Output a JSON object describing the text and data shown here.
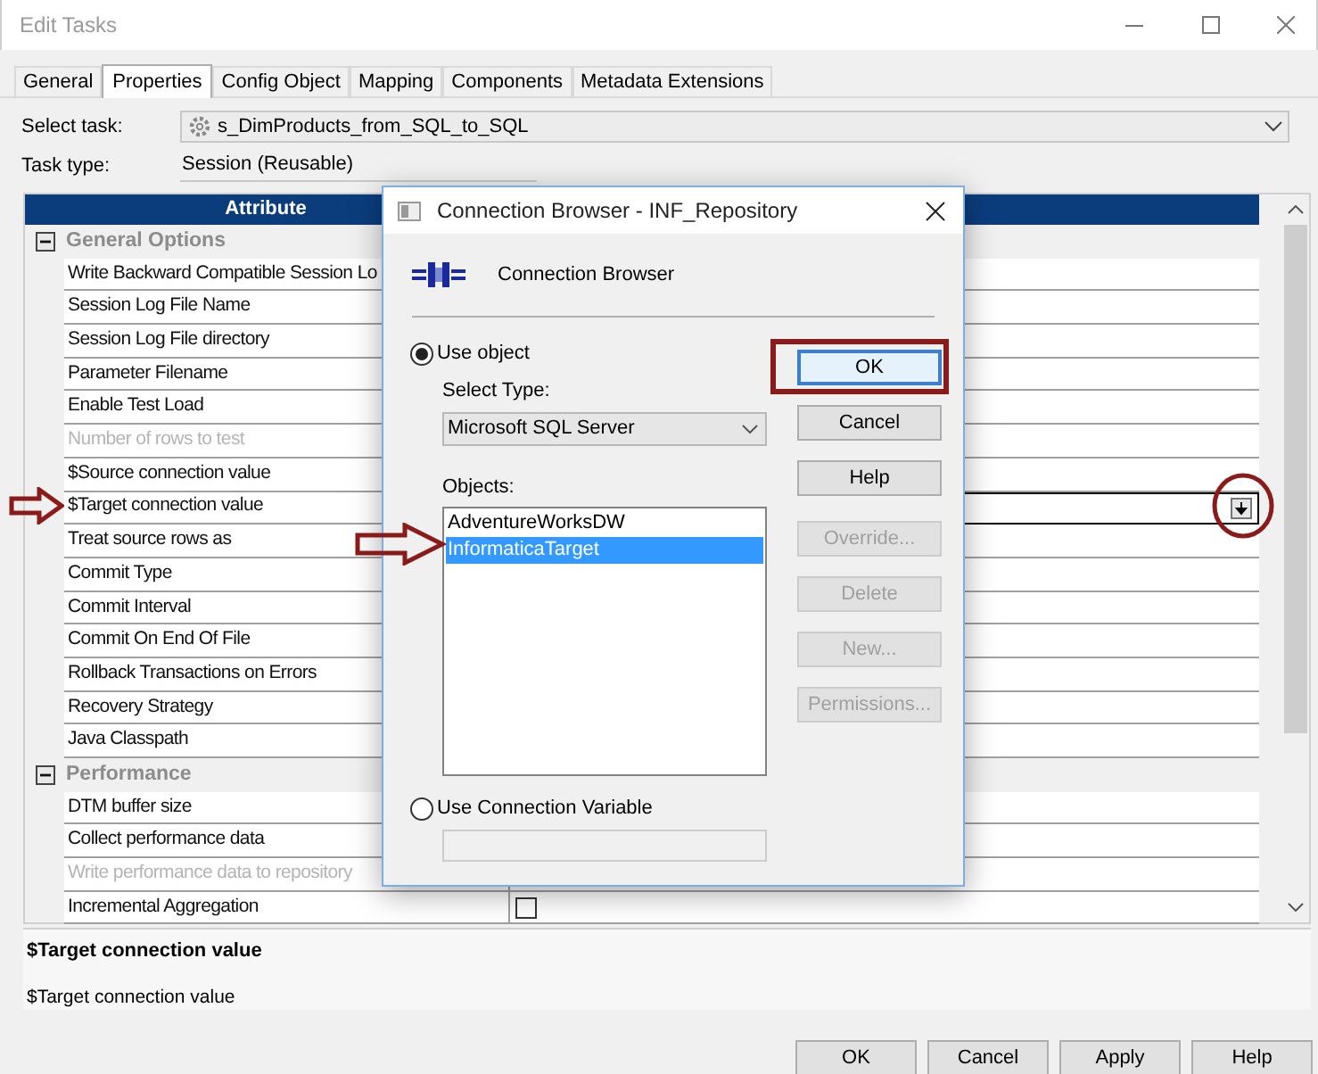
{
  "window": {
    "title": "Edit Tasks"
  },
  "tabs": [
    {
      "label": "General",
      "selected": false
    },
    {
      "label": "Properties",
      "selected": true
    },
    {
      "label": "Config Object",
      "selected": false
    },
    {
      "label": "Mapping",
      "selected": false
    },
    {
      "label": "Components",
      "selected": false
    },
    {
      "label": "Metadata Extensions",
      "selected": false
    }
  ],
  "select_task": {
    "label": "Select task:",
    "value": "s_DimProducts_from_SQL_to_SQL"
  },
  "task_type": {
    "label": "Task type:",
    "value": "Session (Reusable)"
  },
  "grid": {
    "columns": [
      "Attribute"
    ],
    "groups": [
      {
        "name": "General Options",
        "expanded": true,
        "rows": [
          {
            "attribute": "Write Backward Compatible Session Lo",
            "kind": "text",
            "disabled": false,
            "selected": false
          },
          {
            "attribute": "Session Log File Name",
            "kind": "text",
            "disabled": false,
            "selected": false
          },
          {
            "attribute": "Session Log File directory",
            "kind": "text",
            "disabled": false,
            "selected": false
          },
          {
            "attribute": "Parameter Filename",
            "kind": "text",
            "disabled": false,
            "selected": false
          },
          {
            "attribute": "Enable Test Load",
            "kind": "text",
            "disabled": false,
            "selected": false
          },
          {
            "attribute": "Number of rows to test",
            "kind": "text",
            "disabled": true,
            "selected": false
          },
          {
            "attribute": "$Source connection value",
            "kind": "text",
            "disabled": false,
            "selected": false
          },
          {
            "attribute": "$Target connection value",
            "kind": "text",
            "disabled": false,
            "selected": true
          },
          {
            "attribute": "Treat source rows as",
            "kind": "text",
            "disabled": false,
            "selected": false
          },
          {
            "attribute": "Commit Type",
            "kind": "text",
            "disabled": false,
            "selected": false
          },
          {
            "attribute": "Commit Interval",
            "kind": "text",
            "disabled": false,
            "selected": false
          },
          {
            "attribute": "Commit On End Of File",
            "kind": "text",
            "disabled": false,
            "selected": false
          },
          {
            "attribute": "Rollback Transactions on Errors",
            "kind": "text",
            "disabled": false,
            "selected": false
          },
          {
            "attribute": "Recovery Strategy",
            "kind": "text",
            "disabled": false,
            "selected": false
          },
          {
            "attribute": "Java Classpath",
            "kind": "text",
            "disabled": false,
            "selected": false
          }
        ]
      },
      {
        "name": "Performance",
        "expanded": true,
        "rows": [
          {
            "attribute": "DTM buffer size",
            "kind": "text",
            "disabled": false,
            "selected": false
          },
          {
            "attribute": "Collect performance data",
            "kind": "text",
            "disabled": false,
            "selected": false
          },
          {
            "attribute": "Write performance data to repository",
            "kind": "text",
            "disabled": true,
            "selected": false
          },
          {
            "attribute": "Incremental Aggregation",
            "kind": "checkbox",
            "checked": false,
            "disabled": false,
            "selected": false
          }
        ]
      }
    ]
  },
  "description": {
    "title": "$Target connection value",
    "text": "$Target connection value"
  },
  "buttons": [
    "OK",
    "Cancel",
    "Apply",
    "Help"
  ],
  "dialog": {
    "title": "Connection Browser - INF_Repository",
    "header": "Connection Browser",
    "options": [
      {
        "label": "Use object",
        "selected": true
      },
      {
        "label": "Use Connection Variable",
        "selected": false
      }
    ],
    "select_type": {
      "label": "Select Type:",
      "value": "Microsoft SQL Server"
    },
    "objects": {
      "label": "Objects:",
      "items": [
        {
          "label": "AdventureWorksDW",
          "selected": false
        },
        {
          "label": "InformaticaTarget",
          "selected": true
        }
      ]
    },
    "variable_field": {
      "disabled": true
    },
    "buttons": [
      {
        "label": "OK",
        "disabled": false,
        "focused": true
      },
      {
        "label": "Cancel",
        "disabled": false,
        "focused": false
      },
      {
        "label": "Help",
        "disabled": false,
        "focused": false
      },
      {
        "label": "Override...",
        "disabled": true,
        "focused": false
      },
      {
        "label": "Delete",
        "disabled": true,
        "focused": false
      },
      {
        "label": "New...",
        "disabled": true,
        "focused": false
      },
      {
        "label": "Permissions...",
        "disabled": true,
        "focused": false
      }
    ]
  }
}
